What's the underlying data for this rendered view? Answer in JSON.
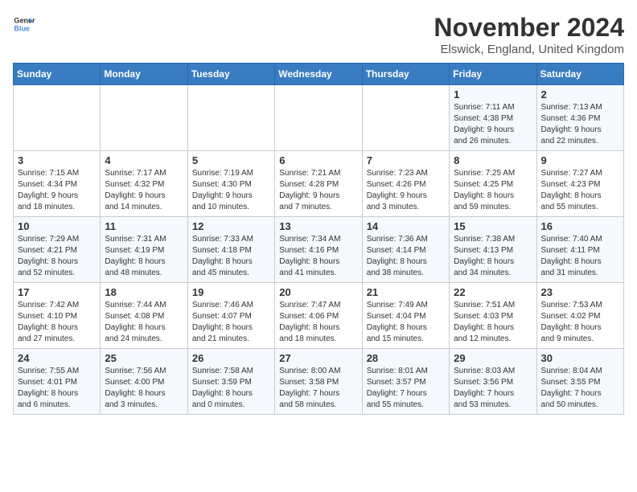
{
  "header": {
    "logo_line1": "General",
    "logo_line2": "Blue",
    "month_title": "November 2024",
    "location": "Elswick, England, United Kingdom"
  },
  "days_of_week": [
    "Sunday",
    "Monday",
    "Tuesday",
    "Wednesday",
    "Thursday",
    "Friday",
    "Saturday"
  ],
  "weeks": [
    [
      {
        "day": "",
        "info": ""
      },
      {
        "day": "",
        "info": ""
      },
      {
        "day": "",
        "info": ""
      },
      {
        "day": "",
        "info": ""
      },
      {
        "day": "",
        "info": ""
      },
      {
        "day": "1",
        "info": "Sunrise: 7:11 AM\nSunset: 4:38 PM\nDaylight: 9 hours\nand 26 minutes."
      },
      {
        "day": "2",
        "info": "Sunrise: 7:13 AM\nSunset: 4:36 PM\nDaylight: 9 hours\nand 22 minutes."
      }
    ],
    [
      {
        "day": "3",
        "info": "Sunrise: 7:15 AM\nSunset: 4:34 PM\nDaylight: 9 hours\nand 18 minutes."
      },
      {
        "day": "4",
        "info": "Sunrise: 7:17 AM\nSunset: 4:32 PM\nDaylight: 9 hours\nand 14 minutes."
      },
      {
        "day": "5",
        "info": "Sunrise: 7:19 AM\nSunset: 4:30 PM\nDaylight: 9 hours\nand 10 minutes."
      },
      {
        "day": "6",
        "info": "Sunrise: 7:21 AM\nSunset: 4:28 PM\nDaylight: 9 hours\nand 7 minutes."
      },
      {
        "day": "7",
        "info": "Sunrise: 7:23 AM\nSunset: 4:26 PM\nDaylight: 9 hours\nand 3 minutes."
      },
      {
        "day": "8",
        "info": "Sunrise: 7:25 AM\nSunset: 4:25 PM\nDaylight: 8 hours\nand 59 minutes."
      },
      {
        "day": "9",
        "info": "Sunrise: 7:27 AM\nSunset: 4:23 PM\nDaylight: 8 hours\nand 55 minutes."
      }
    ],
    [
      {
        "day": "10",
        "info": "Sunrise: 7:29 AM\nSunset: 4:21 PM\nDaylight: 8 hours\nand 52 minutes."
      },
      {
        "day": "11",
        "info": "Sunrise: 7:31 AM\nSunset: 4:19 PM\nDaylight: 8 hours\nand 48 minutes."
      },
      {
        "day": "12",
        "info": "Sunrise: 7:33 AM\nSunset: 4:18 PM\nDaylight: 8 hours\nand 45 minutes."
      },
      {
        "day": "13",
        "info": "Sunrise: 7:34 AM\nSunset: 4:16 PM\nDaylight: 8 hours\nand 41 minutes."
      },
      {
        "day": "14",
        "info": "Sunrise: 7:36 AM\nSunset: 4:14 PM\nDaylight: 8 hours\nand 38 minutes."
      },
      {
        "day": "15",
        "info": "Sunrise: 7:38 AM\nSunset: 4:13 PM\nDaylight: 8 hours\nand 34 minutes."
      },
      {
        "day": "16",
        "info": "Sunrise: 7:40 AM\nSunset: 4:11 PM\nDaylight: 8 hours\nand 31 minutes."
      }
    ],
    [
      {
        "day": "17",
        "info": "Sunrise: 7:42 AM\nSunset: 4:10 PM\nDaylight: 8 hours\nand 27 minutes."
      },
      {
        "day": "18",
        "info": "Sunrise: 7:44 AM\nSunset: 4:08 PM\nDaylight: 8 hours\nand 24 minutes."
      },
      {
        "day": "19",
        "info": "Sunrise: 7:46 AM\nSunset: 4:07 PM\nDaylight: 8 hours\nand 21 minutes."
      },
      {
        "day": "20",
        "info": "Sunrise: 7:47 AM\nSunset: 4:06 PM\nDaylight: 8 hours\nand 18 minutes."
      },
      {
        "day": "21",
        "info": "Sunrise: 7:49 AM\nSunset: 4:04 PM\nDaylight: 8 hours\nand 15 minutes."
      },
      {
        "day": "22",
        "info": "Sunrise: 7:51 AM\nSunset: 4:03 PM\nDaylight: 8 hours\nand 12 minutes."
      },
      {
        "day": "23",
        "info": "Sunrise: 7:53 AM\nSunset: 4:02 PM\nDaylight: 8 hours\nand 9 minutes."
      }
    ],
    [
      {
        "day": "24",
        "info": "Sunrise: 7:55 AM\nSunset: 4:01 PM\nDaylight: 8 hours\nand 6 minutes."
      },
      {
        "day": "25",
        "info": "Sunrise: 7:56 AM\nSunset: 4:00 PM\nDaylight: 8 hours\nand 3 minutes."
      },
      {
        "day": "26",
        "info": "Sunrise: 7:58 AM\nSunset: 3:59 PM\nDaylight: 8 hours\nand 0 minutes."
      },
      {
        "day": "27",
        "info": "Sunrise: 8:00 AM\nSunset: 3:58 PM\nDaylight: 7 hours\nand 58 minutes."
      },
      {
        "day": "28",
        "info": "Sunrise: 8:01 AM\nSunset: 3:57 PM\nDaylight: 7 hours\nand 55 minutes."
      },
      {
        "day": "29",
        "info": "Sunrise: 8:03 AM\nSunset: 3:56 PM\nDaylight: 7 hours\nand 53 minutes."
      },
      {
        "day": "30",
        "info": "Sunrise: 8:04 AM\nSunset: 3:55 PM\nDaylight: 7 hours\nand 50 minutes."
      }
    ]
  ]
}
